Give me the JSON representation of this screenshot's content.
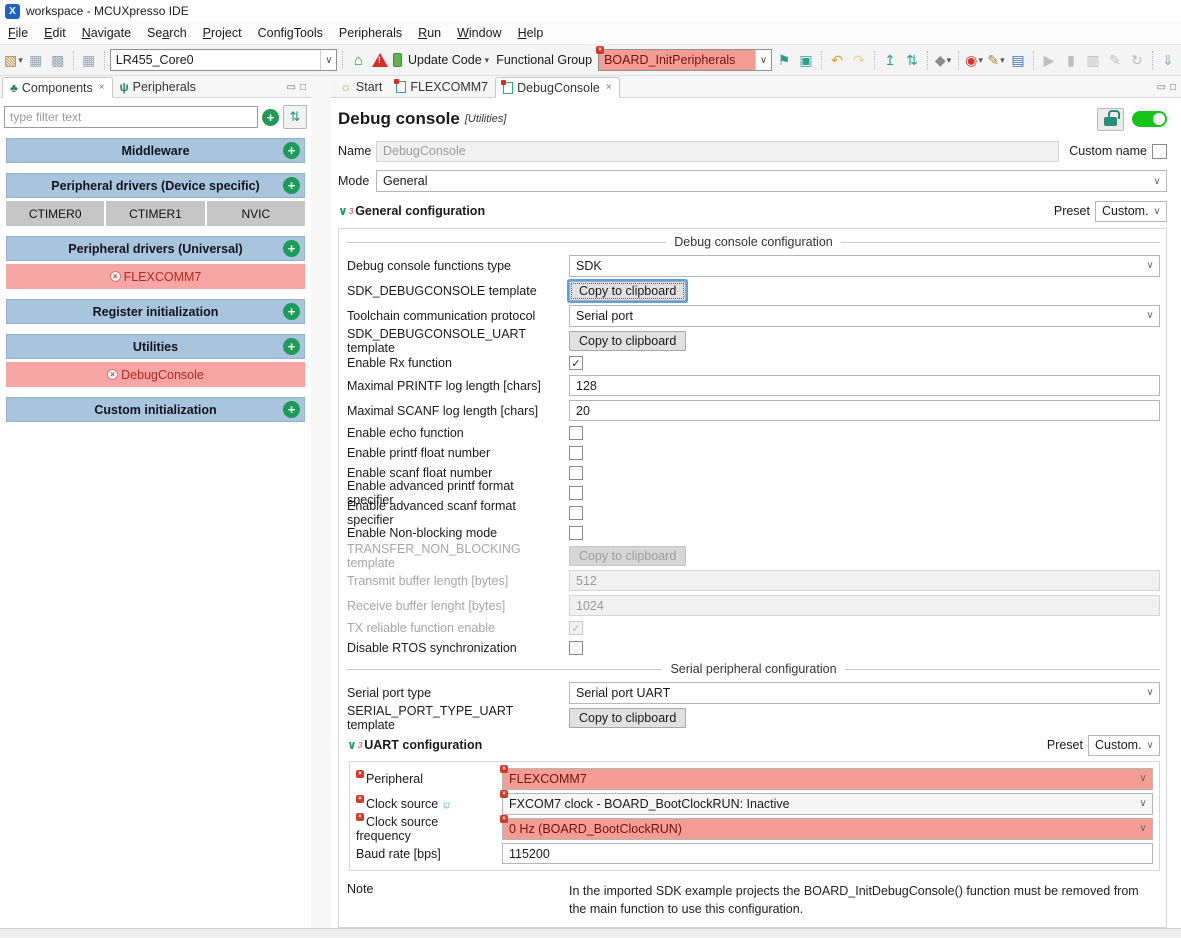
{
  "titlebar": {
    "title": "workspace - MCUXpresso IDE",
    "logo": "X"
  },
  "menubar": {
    "items": [
      {
        "label": "File",
        "u": 0
      },
      {
        "label": "Edit",
        "u": 0
      },
      {
        "label": "Navigate",
        "u": 0
      },
      {
        "label": "Search",
        "u": 2
      },
      {
        "label": "Project",
        "u": 0
      },
      {
        "label": "ConfigTools",
        "u": -1
      },
      {
        "label": "Peripherals",
        "u": -1
      },
      {
        "label": "Run",
        "u": 0
      },
      {
        "label": "Window",
        "u": 0
      },
      {
        "label": "Help",
        "u": 0
      }
    ]
  },
  "toolbar": {
    "project_selector": "LR455_Core0",
    "update_code_label": "Update Code",
    "functional_group_label": "Functional Group",
    "functional_group_value": "BOARD_InitPeripherals",
    "left_icons": [
      {
        "name": "new-wizard-icon",
        "glyph": "▧",
        "color": "#b8873b",
        "dropdown": true
      },
      {
        "name": "save-icon",
        "glyph": "▦",
        "color": "#98a6b4"
      },
      {
        "name": "save-all-icon",
        "glyph": "▩",
        "color": "#98a6b4"
      },
      {
        "name": "sep"
      },
      {
        "name": "save-binary-icon",
        "glyph": "▦",
        "color": "#98a6b4"
      },
      {
        "name": "sep"
      }
    ],
    "right_icons": [
      {
        "name": "pin-view-icon",
        "glyph": "⚑",
        "color": "#2a9d8f"
      },
      {
        "name": "overview-icon",
        "glyph": "▣",
        "color": "#2a9d8f"
      },
      {
        "name": "sep"
      },
      {
        "name": "undo-icon",
        "glyph": "↶",
        "color": "#d9a61a"
      },
      {
        "name": "redo-icon",
        "glyph": "↷",
        "color": "#e6cf9a"
      },
      {
        "name": "sep"
      },
      {
        "name": "export-icon",
        "glyph": "↥",
        "color": "#2a9d8f"
      },
      {
        "name": "sort-functional-groups-icon",
        "glyph": "⇅",
        "color": "#2a9d8f"
      },
      {
        "name": "sep"
      },
      {
        "name": "components-menu-icon",
        "glyph": "◆",
        "color": "#8a8a8a",
        "dropdown": true
      },
      {
        "name": "sep"
      },
      {
        "name": "run-config-icon",
        "glyph": "◉",
        "color": "#d23b2f",
        "dropdown": true
      },
      {
        "name": "tools-icon",
        "glyph": "✎",
        "color": "#b0893a",
        "dropdown": true
      },
      {
        "name": "console-icon",
        "glyph": "▤",
        "color": "#3b6fb5"
      },
      {
        "name": "sep"
      },
      {
        "name": "play-icon",
        "glyph": "▶",
        "color": "#bdbdbd",
        "disabled": true
      },
      {
        "name": "pause-icon",
        "glyph": "▮",
        "color": "#bdbdbd",
        "disabled": true
      },
      {
        "name": "duplicate-icon",
        "glyph": "▥",
        "color": "#bdbdbd",
        "disabled": true
      },
      {
        "name": "edit-gray-icon",
        "glyph": "✎",
        "color": "#bdbdbd",
        "disabled": true
      },
      {
        "name": "refresh-icon",
        "glyph": "↻",
        "color": "#bdbdbd",
        "disabled": true
      },
      {
        "name": "sep"
      },
      {
        "name": "import-icon",
        "glyph": "⇓",
        "color": "#9aa6ad"
      }
    ]
  },
  "sidebar": {
    "tabs": [
      {
        "label": "Components"
      },
      {
        "label": "Peripherals"
      }
    ],
    "filter_placeholder": "type filter text",
    "groups": [
      {
        "header": "Middleware"
      },
      {
        "header": "Peripheral drivers (Device specific)",
        "chips": [
          "CTIMER0",
          "CTIMER1",
          "NVIC"
        ]
      },
      {
        "header": "Peripheral drivers (Universal)",
        "errors": [
          "FLEXCOMM7"
        ]
      },
      {
        "header": "Register initialization"
      },
      {
        "header": "Utilities",
        "errors": [
          "DebugConsole"
        ]
      },
      {
        "header": "Custom initialization"
      }
    ]
  },
  "editor": {
    "tabs": [
      {
        "label": "Start"
      },
      {
        "label": "FLEXCOMM7"
      },
      {
        "label": "DebugConsole"
      }
    ],
    "title": "Debug console",
    "title_suffix": "[Utilities]",
    "name_label": "Name",
    "name_value": "DebugConsole",
    "custom_name_label": "Custom name",
    "mode_label": "Mode",
    "mode_value": "General",
    "general_header": "General configuration",
    "preset_label": "Preset",
    "preset_value": "Custom...",
    "debug_group_title": "Debug console configuration",
    "general_rows": [
      {
        "label": "Debug console functions type",
        "control": "select",
        "value": "SDK"
      },
      {
        "label": "SDK_DEBUGCONSOLE template",
        "control": "button",
        "value": "Copy to clipboard",
        "focus": true
      },
      {
        "label": "Toolchain communication protocol",
        "control": "select",
        "value": "Serial port"
      },
      {
        "label": "SDK_DEBUGCONSOLE_UART template",
        "control": "button",
        "value": "Copy to clipboard"
      },
      {
        "label": "Enable Rx function",
        "control": "checkbox",
        "checked": true
      },
      {
        "label": "Maximal PRINTF log length [chars]",
        "control": "input",
        "value": "128"
      },
      {
        "label": "Maximal SCANF log length [chars]",
        "control": "input",
        "value": "20"
      },
      {
        "label": "Enable echo function",
        "control": "checkbox",
        "checked": false
      },
      {
        "label": "Enable printf float number",
        "control": "checkbox",
        "checked": false
      },
      {
        "label": "Enable scanf float number",
        "control": "checkbox",
        "checked": false
      },
      {
        "label": "Enable advanced printf format specifier",
        "control": "checkbox",
        "checked": false
      },
      {
        "label": "Enable advanced scanf format specifier",
        "control": "checkbox",
        "checked": false
      },
      {
        "label": "Enable Non-blocking mode",
        "control": "checkbox",
        "checked": false
      },
      {
        "label": "TRANSFER_NON_BLOCKING template",
        "control": "button",
        "value": "Copy to clipboard",
        "disabled": true
      },
      {
        "label": "Transmit buffer length [bytes]",
        "control": "input",
        "value": "512",
        "disabled": true
      },
      {
        "label": "Receive buffer lenght [bytes]",
        "control": "input",
        "value": "1024",
        "disabled": true
      },
      {
        "label": "TX reliable function enable",
        "control": "checkbox",
        "checked": true,
        "disabled": true
      },
      {
        "label": "Disable RTOS synchronization",
        "control": "checkbox",
        "checked": false
      }
    ],
    "serial_group_title": "Serial peripheral configuration",
    "serial_rows": [
      {
        "label": "Serial port type",
        "control": "select",
        "value": "Serial port UART"
      },
      {
        "label": "SERIAL_PORT_TYPE_UART template",
        "control": "button",
        "value": "Copy to clipboard"
      }
    ],
    "uart_header": "UART configuration",
    "uart_preset_label": "Preset",
    "uart_preset_value": "Custom...",
    "uart_rows": [
      {
        "label": "Peripheral",
        "control": "select",
        "value": "FLEXCOMM7",
        "error": true,
        "badge": true
      },
      {
        "label": "Clock source",
        "control": "select",
        "value": "FXCOM7 clock - BOARD_BootClockRUN: Inactive",
        "gray": true,
        "badge": true,
        "bulb": true
      },
      {
        "label": "Clock source frequency",
        "control": "select",
        "value": "0 Hz (BOARD_BootClockRUN)",
        "error": true,
        "badge": true
      },
      {
        "label": "Baud rate [bps]",
        "control": "input",
        "value": "115200"
      }
    ],
    "note_label": "Note",
    "note_text": "In the imported SDK example projects the BOARD_InitDebugConsole() function must be removed from the main function to use this configuration."
  },
  "colors": {
    "error_bg": "#f59c95",
    "header_blue": "#a9c4dd",
    "toggle_green": "#17c317",
    "accent_teal": "#2a9d8f"
  }
}
